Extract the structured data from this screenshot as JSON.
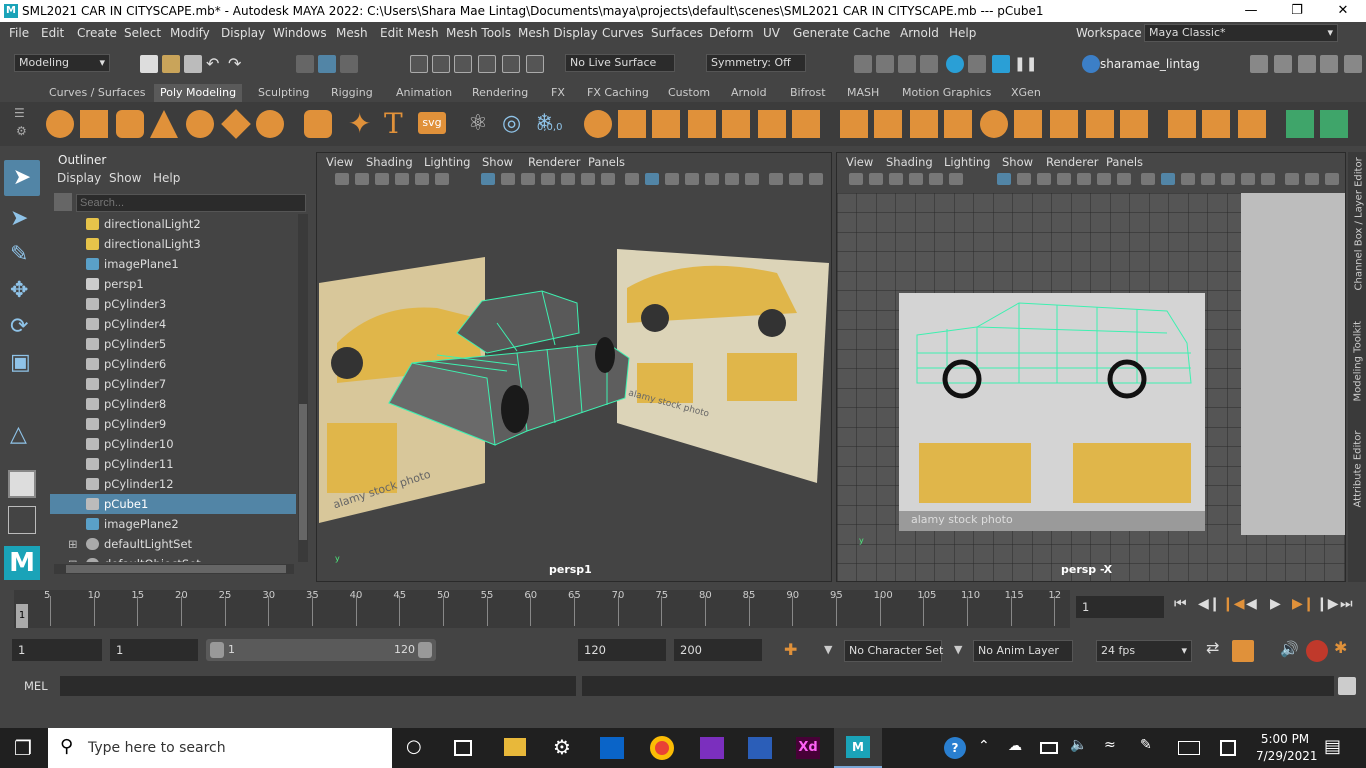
{
  "title": "SML2021 CAR IN CITYSCAPE.mb* - Autodesk MAYA 2022: C:\\Users\\Shara Mae Lintag\\Documents\\maya\\projects\\default\\scenes\\SML2021 CAR IN CITYSCAPE.mb   ---   pCube1",
  "menus": [
    "File",
    "Edit",
    "Create",
    "Select",
    "Modify",
    "Display",
    "Windows",
    "Mesh",
    "Edit Mesh",
    "Mesh Tools",
    "Mesh Display",
    "Curves",
    "Surfaces",
    "Deform",
    "UV",
    "Generate",
    "Cache",
    "Arnold",
    "Help"
  ],
  "workspace": {
    "label": "Workspace :",
    "value": "Maya Classic*"
  },
  "status": {
    "mode": "Modeling",
    "live_surface": "No Live Surface",
    "symmetry": "Symmetry: Off",
    "user": "sharamae_lintag"
  },
  "shelf_tabs": [
    "Curves / Surfaces",
    "Poly Modeling",
    "Sculpting",
    "Rigging",
    "Animation",
    "Rendering",
    "FX",
    "FX Caching",
    "Custom",
    "Arnold",
    "Bifrost",
    "MASH",
    "Motion Graphics",
    "XGen"
  ],
  "shelf_icon_label": "0,0,0",
  "shelf_svg_label": "svg",
  "shelf_text_label": "T",
  "outliner": {
    "title": "Outliner",
    "menus": [
      "Display",
      "Show",
      "Help"
    ],
    "search_placeholder": "Search...",
    "items": [
      {
        "label": "directionalLight2",
        "icon": "directional-light-icon"
      },
      {
        "label": "directionalLight3",
        "icon": "directional-light-icon"
      },
      {
        "label": "imagePlane1",
        "icon": "image-plane-icon"
      },
      {
        "label": "persp1",
        "icon": "camera-icon"
      },
      {
        "label": "pCylinder3",
        "icon": "mesh-icon"
      },
      {
        "label": "pCylinder4",
        "icon": "mesh-icon"
      },
      {
        "label": "pCylinder5",
        "icon": "mesh-icon"
      },
      {
        "label": "pCylinder6",
        "icon": "mesh-icon"
      },
      {
        "label": "pCylinder7",
        "icon": "mesh-icon"
      },
      {
        "label": "pCylinder8",
        "icon": "mesh-icon"
      },
      {
        "label": "pCylinder9",
        "icon": "mesh-icon"
      },
      {
        "label": "pCylinder10",
        "icon": "mesh-icon"
      },
      {
        "label": "pCylinder11",
        "icon": "mesh-icon"
      },
      {
        "label": "pCylinder12",
        "icon": "mesh-icon"
      },
      {
        "label": "pCube1",
        "icon": "mesh-icon",
        "selected": true
      },
      {
        "label": "imagePlane2",
        "icon": "image-plane-icon"
      },
      {
        "label": "defaultLightSet",
        "icon": "set-icon"
      },
      {
        "label": "defaultObjectSet",
        "icon": "set-icon"
      }
    ]
  },
  "viewport_menus": [
    "View",
    "Shading",
    "Lighting",
    "Show",
    "Renderer",
    "Panels"
  ],
  "viewport_left": {
    "name": "persp1",
    "watermark": "alamy stock photo"
  },
  "viewport_right": {
    "name": "persp -X",
    "watermark": "alamy stock photo"
  },
  "side_tabs": [
    "Channel Box / Layer Editor",
    "Modeling Toolkit",
    "Attribute Editor"
  ],
  "timeline": {
    "ticks": [
      "5",
      "10",
      "15",
      "20",
      "25",
      "30",
      "35",
      "40",
      "45",
      "50",
      "55",
      "60",
      "65",
      "70",
      "75",
      "80",
      "85",
      "90",
      "95",
      "100",
      "105",
      "110",
      "115",
      "12"
    ],
    "first": "1",
    "current_frame": "1"
  },
  "range": {
    "start": "1",
    "playback_start": "1",
    "slider_start": "1",
    "slider_end": "120",
    "playback_end": "120",
    "end": "200",
    "character_set": "No Character Set",
    "anim_layer": "No Anim Layer",
    "fps": "24 fps"
  },
  "cmdline": {
    "label": "MEL"
  },
  "taskbar": {
    "search": "Type here to search",
    "time": "5:00 PM",
    "date": "7/29/2021"
  },
  "colors": {
    "accent": "#5285a6",
    "wire": "#3ef0b0",
    "taxi": "#e0b64a"
  }
}
